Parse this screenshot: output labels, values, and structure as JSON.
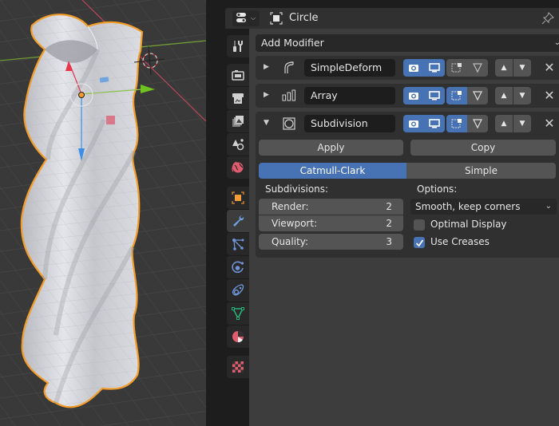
{
  "viewport": {
    "object_name": "Circle",
    "colors": {
      "selection_outline": "#f39c28",
      "x_axis": "#c7415a",
      "y_axis": "#7fb12c",
      "z_gizmo": "#3a8fe6",
      "mesh": "#d4d5da",
      "grid_bg": "#393939"
    }
  },
  "header": {
    "editor_type_icon": "properties-editor-icon",
    "object_icon": "object-data-icon",
    "object_name": "Circle",
    "pin_icon": "pin-icon"
  },
  "tabs": [
    {
      "name": "tool",
      "icon": "tool-icon",
      "active": false
    },
    {
      "name": "render",
      "icon": "camera-back-icon",
      "active": false
    },
    {
      "name": "output",
      "icon": "printer-icon",
      "active": false
    },
    {
      "name": "view-layer",
      "icon": "image-stack-icon",
      "active": false
    },
    {
      "name": "scene",
      "icon": "scene-icon",
      "active": false
    },
    {
      "name": "world",
      "icon": "world-icon",
      "active": false
    },
    {
      "name": "object",
      "icon": "object-icon",
      "active": false
    },
    {
      "name": "modifiers",
      "icon": "wrench-icon",
      "active": true
    },
    {
      "name": "particles",
      "icon": "particles-icon",
      "active": false
    },
    {
      "name": "physics",
      "icon": "physics-icon",
      "active": false
    },
    {
      "name": "constraints",
      "icon": "constraint-icon",
      "active": false
    },
    {
      "name": "data",
      "icon": "mesh-data-icon",
      "active": false
    },
    {
      "name": "material",
      "icon": "material-icon",
      "active": false
    },
    {
      "name": "texture",
      "icon": "texture-icon",
      "active": false
    }
  ],
  "add_modifier": {
    "label": "Add Modifier"
  },
  "modifiers": [
    {
      "name": "SimpleDeform",
      "icon": "simple-deform-icon",
      "expanded": false,
      "render": true,
      "viewport": true,
      "editmode": false,
      "cage": false
    },
    {
      "name": "Array",
      "icon": "array-icon",
      "expanded": false,
      "render": true,
      "viewport": true,
      "editmode": true,
      "cage": false
    },
    {
      "name": "Subdivision",
      "icon": "subdivision-icon",
      "expanded": true,
      "render": true,
      "viewport": true,
      "editmode": true,
      "cage": false
    }
  ],
  "subdivision": {
    "apply_label": "Apply",
    "copy_label": "Copy",
    "algorithms": [
      "Catmull-Clark",
      "Simple"
    ],
    "selected_algorithm": "Catmull-Clark",
    "subdivisions_label": "Subdivisions:",
    "render_label": "Render:",
    "render_value": "2",
    "viewport_label": "Viewport:",
    "viewport_value": "2",
    "quality_label": "Quality:",
    "quality_value": "3",
    "options_label": "Options:",
    "uv_smooth": "Smooth, keep corners",
    "optimal_display_label": "Optimal Display",
    "optimal_display": false,
    "use_creases_label": "Use Creases",
    "use_creases": true
  },
  "colors": {
    "accent": "#4772b3",
    "panel_bg": "#3d3d3d",
    "subpanel_bg": "#303030",
    "field_bg": "#282828",
    "button_bg": "#545454"
  }
}
